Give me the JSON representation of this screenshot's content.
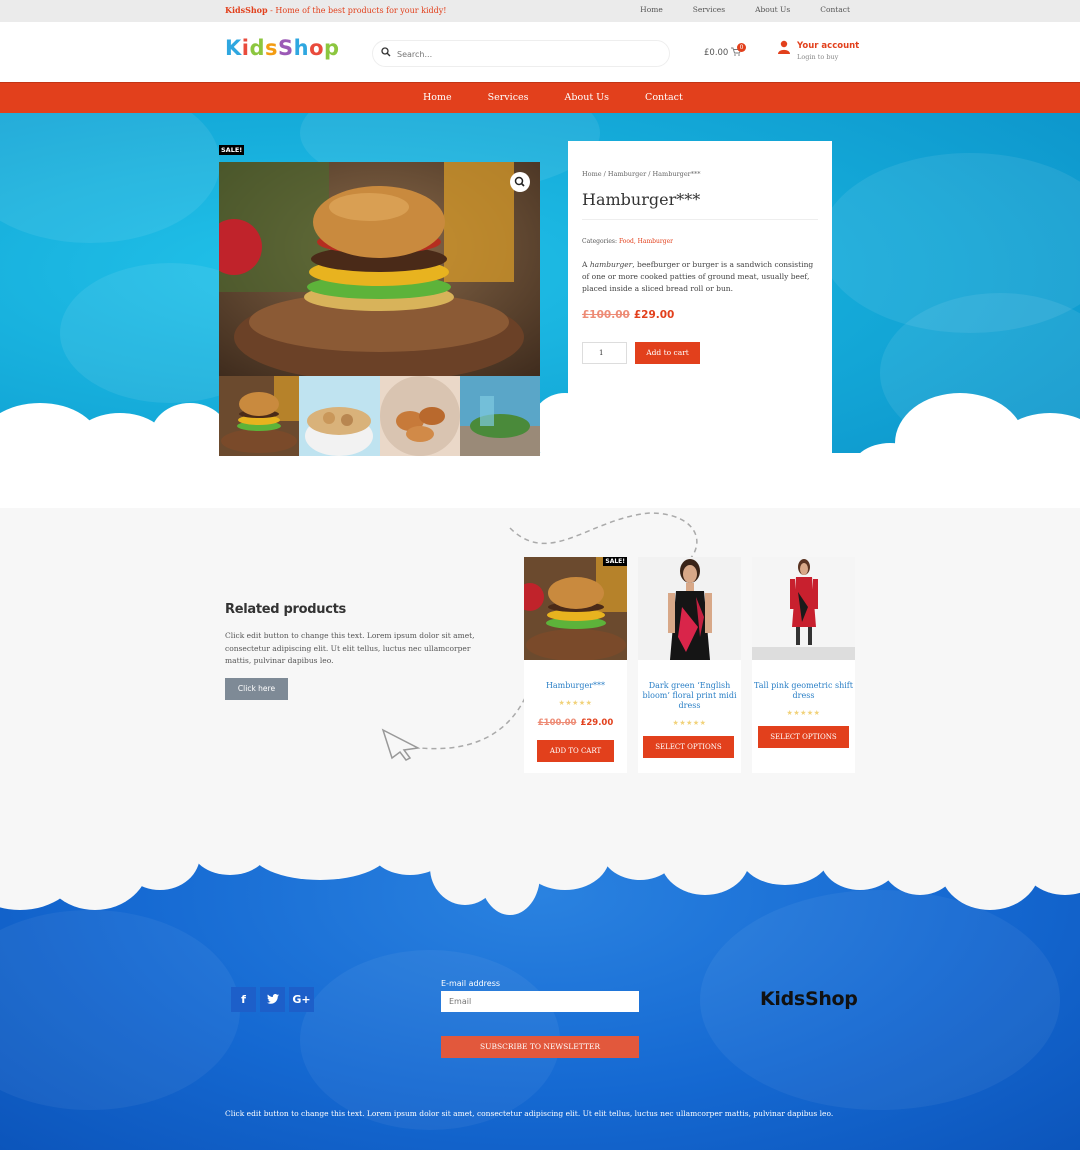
{
  "topbar": {
    "brand": "KidsShop",
    "tagline": " - Home of the best products for your kiddy!",
    "links": [
      "Home",
      "Services",
      "About Us",
      "Contact"
    ]
  },
  "header": {
    "logo_letters": [
      "K",
      "i",
      "d",
      "s",
      "S",
      "h",
      "o",
      "p"
    ],
    "search_placeholder": "Search...",
    "cart_total": "£0.00",
    "cart_count": "0",
    "account_title": "Your account",
    "account_sub": "Login to buy"
  },
  "nav": {
    "links": [
      "Home",
      "Services",
      "About Us",
      "Contact"
    ]
  },
  "product": {
    "sale_badge": "SALE!",
    "breadcrumb": "Home / Hamburger / Hamburger***",
    "title": "Hamburger***",
    "categories_label": "Categories:",
    "categories": "Food, Hamburger",
    "description_prefix": "A ",
    "description_em": "hamburger",
    "description_rest": ", beefburger or burger is a sandwich consisting of one or more cooked patties of ground meat, usually beef, placed inside a sliced bread roll or bun.",
    "old_price": "£100.00",
    "new_price": "£29.00",
    "quantity": "1",
    "add_to_cart": "Add to cart"
  },
  "related": {
    "title": "Related products",
    "description": "Click edit button to change this text. Lorem ipsum dolor sit amet, consectetur adipiscing elit. Ut elit tellus, luctus nec ullamcorper mattis, pulvinar dapibus leo.",
    "button": "Click here",
    "items": [
      {
        "name": "Hamburger***",
        "stars": "★★★★★",
        "old_price": "£100.00",
        "new_price": "£29.00",
        "button": "ADD TO CART",
        "badge": "SALE!"
      },
      {
        "name": "Dark green ‘English bloom’ floral print midi dress",
        "stars": "★★★★★",
        "button": "SELECT OPTIONS"
      },
      {
        "name": "Tall pink geometric shift dress",
        "stars": "★★★★★",
        "button": "SELECT OPTIONS"
      }
    ]
  },
  "footer": {
    "social": [
      "f",
      "t",
      "G+"
    ],
    "email_label": "E-mail address",
    "email_placeholder": "Email",
    "subscribe": "SUBSCRIBE TO NEWSLETTER",
    "logo": "KidsShop",
    "note": "Click edit button to change this text. Lorem ipsum dolor sit amet, consectetur adipiscing elit. Ut elit tellus, luctus nec ullamcorper mattis, pulvinar dapibus leo."
  },
  "colors": {
    "accent": "#e2401c",
    "link": "#2a7fc6",
    "hero_blue": "#14a9d8",
    "footer_blue": "#1569d2"
  }
}
